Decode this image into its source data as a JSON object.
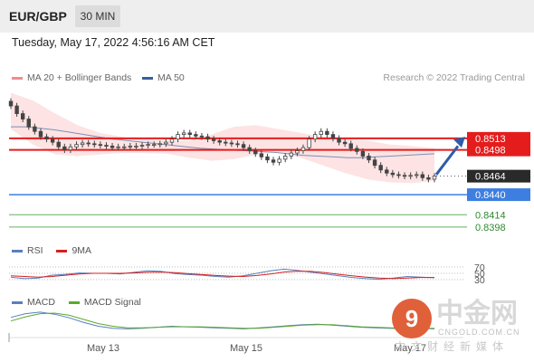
{
  "header": {
    "symbol": "EUR/GBP",
    "timeframe": "30 MIN"
  },
  "datetime": "Tuesday, May 17, 2022 4:56:16 AM CET",
  "legend": {
    "boll_label": "MA 20 + Bollinger Bands",
    "ma50_label": "MA 50"
  },
  "credit": "Research © 2022 Trading Central",
  "rsi_legend": {
    "rsi_label": "RSI",
    "ma_label": "9MA"
  },
  "macd_legend": {
    "macd_label": "MACD",
    "signal_label": "MACD Signal"
  },
  "watermark": {
    "glyph": "9",
    "brand": "中金网",
    "url": "CNGOLD.COM.CN",
    "sub": "中文财经新媒体"
  },
  "colors": {
    "resistance": "#e51c1c",
    "support": "#3d7ee0",
    "pivot_support": "#2e8a2e",
    "candle": "#444444",
    "bollinger_fill": "#fde3e3",
    "arrow": "#2d5ca8"
  },
  "chart_data": {
    "type": "candlestick",
    "symbol": "EUR/GBP",
    "timeframe": "30 MIN",
    "x_ticks": [
      "May 13",
      "May 15",
      "May 17"
    ],
    "ylim": [
      0.8385,
      0.8575
    ],
    "price_levels": [
      {
        "label": "0.8513",
        "value": 0.8513,
        "kind": "resistance"
      },
      {
        "label": "0.8498",
        "value": 0.8498,
        "kind": "resistance"
      },
      {
        "label": "0.8464",
        "value": 0.8464,
        "kind": "last"
      },
      {
        "label": "0.8440",
        "value": 0.844,
        "kind": "pivot"
      },
      {
        "label": "0.8414",
        "value": 0.8414,
        "kind": "support"
      },
      {
        "label": "0.8398",
        "value": 0.8398,
        "kind": "support"
      }
    ],
    "close": [
      0.8555,
      0.8545,
      0.8538,
      0.8528,
      0.8522,
      0.8515,
      0.8512,
      0.8508,
      0.8502,
      0.8498,
      0.8502,
      0.8505,
      0.8507,
      0.8506,
      0.8505,
      0.8504,
      0.8503,
      0.8501,
      0.8502,
      0.8502,
      0.8503,
      0.8503,
      0.8504,
      0.8505,
      0.8505,
      0.8506,
      0.8508,
      0.8512,
      0.8518,
      0.852,
      0.8518,
      0.8516,
      0.8515,
      0.8512,
      0.851,
      0.8508,
      0.8507,
      0.8506,
      0.8505,
      0.8501,
      0.8497,
      0.8493,
      0.8489,
      0.8485,
      0.8482,
      0.8486,
      0.849,
      0.8494,
      0.8497,
      0.8501,
      0.8512,
      0.8518,
      0.8522,
      0.8518,
      0.8513,
      0.8508,
      0.8506,
      0.85,
      0.8496,
      0.849,
      0.8485,
      0.8478,
      0.8472,
      0.8468,
      0.8466,
      0.8465,
      0.8464,
      0.8465,
      0.8466,
      0.8462,
      0.846,
      0.8464
    ],
    "ma50": [
      0.8528,
      0.8528,
      0.8526,
      0.8524,
      0.8521,
      0.8518,
      0.8515,
      0.8512,
      0.851,
      0.8508,
      0.8506,
      0.8504,
      0.8502,
      0.85,
      0.8499,
      0.8498,
      0.8497,
      0.8496,
      0.8495,
      0.8493,
      0.8491,
      0.849,
      0.8489,
      0.8488,
      0.8488,
      0.8489,
      0.849,
      0.8491,
      0.8492,
      0.8493
    ],
    "bollinger_upper": [
      0.8572,
      0.8562,
      0.8545,
      0.853,
      0.852,
      0.8515,
      0.8512,
      0.851,
      0.851,
      0.8518,
      0.8528,
      0.853,
      0.8525,
      0.852,
      0.8515,
      0.8512,
      0.851,
      0.8505,
      0.8503,
      0.85
    ],
    "bollinger_lower": [
      0.8525,
      0.8505,
      0.8492,
      0.849,
      0.8492,
      0.8494,
      0.8494,
      0.8493,
      0.8488,
      0.8484,
      0.8486,
      0.8492,
      0.8495,
      0.8488,
      0.8478,
      0.8468,
      0.846,
      0.8456,
      0.8455,
      0.8458
    ],
    "rsi_levels": [
      70,
      50,
      30
    ],
    "rsi": [
      38,
      33,
      35,
      44,
      47,
      51,
      50,
      50,
      48,
      53,
      58,
      56,
      49,
      46,
      44,
      40,
      38,
      42,
      50,
      58,
      63,
      59,
      53,
      48,
      42,
      37,
      33,
      31,
      35,
      40,
      38,
      36
    ],
    "rsi_9ma": [
      42,
      40,
      38,
      40,
      44,
      48,
      50,
      50,
      50,
      51,
      53,
      54,
      52,
      49,
      46,
      43,
      41,
      40,
      43,
      48,
      54,
      57,
      56,
      52,
      47,
      42,
      38,
      35,
      33,
      35,
      37,
      37
    ],
    "macd": [
      0.0025,
      0.0032,
      0.0035,
      0.0031,
      0.0024,
      0.0015,
      0.0008,
      0.0004,
      0.0003,
      0.0004,
      0.0006,
      0.0008,
      0.0007,
      0.0006,
      0.0005,
      0.0004,
      0.0003,
      0.0005,
      0.0007,
      0.0009,
      0.0011,
      0.0012,
      0.001,
      0.0008,
      0.0006,
      0.0005,
      0.0004,
      0.0003,
      0.0004,
      0.0003
    ],
    "macd_signal": [
      0.0018,
      0.0026,
      0.0032,
      0.0033,
      0.0029,
      0.0021,
      0.0013,
      0.0008,
      0.0005,
      0.0005,
      0.0006,
      0.0007,
      0.0007,
      0.0007,
      0.0006,
      0.0005,
      0.0004,
      0.0004,
      0.0006,
      0.0008,
      0.001,
      0.0011,
      0.0011,
      0.0009,
      0.0007,
      0.0006,
      0.0005,
      0.0004,
      0.0004,
      0.0004
    ]
  }
}
